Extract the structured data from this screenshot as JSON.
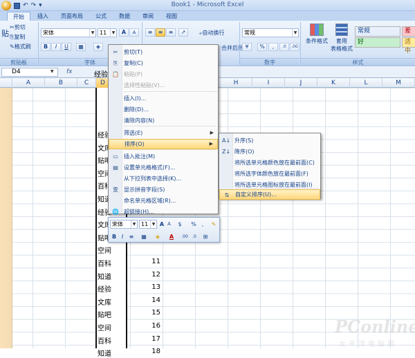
{
  "title_bar": {
    "title": "Book1 - Microsoft Excel",
    "qat": [
      "↶",
      "↷",
      "▾"
    ]
  },
  "tabs": [
    "开始",
    "插入",
    "页面布局",
    "公式",
    "数据",
    "审阅",
    "视图"
  ],
  "ribbon": {
    "clipboard": {
      "paste": "贴",
      "cut": "剪切",
      "copy": "复制",
      "format_painter": "格式刷",
      "label": "剪贴板"
    },
    "font": {
      "name": "宋体",
      "size": "11",
      "grow": "A",
      "shrink": "A",
      "bold": "B",
      "italic": "I",
      "underline": "U",
      "label": "字体"
    },
    "alignment": {
      "wrap": "自动换行",
      "merge": "合并后居中",
      "label": ""
    },
    "number": {
      "format": "常规",
      "percent": "%",
      "comma": ",",
      "label": "数字"
    },
    "styles": {
      "conditional": "条件格式",
      "table_format_1": "套用",
      "table_format_2": "表格格式",
      "cells": [
        {
          "text": "常规",
          "bg": "#ffffff",
          "fg": "#000000"
        },
        {
          "text": "差",
          "bg": "#ffc7ce",
          "fg": "#9c0006"
        },
        {
          "text": "好",
          "bg": "#c6efce",
          "fg": "#006100"
        },
        {
          "text": "适中",
          "bg": "#ffeb9c",
          "fg": "#9c6500"
        }
      ],
      "label": "样式"
    }
  },
  "formula_bar": {
    "name_box": "D4",
    "value": "经验"
  },
  "columns": [
    "A",
    "B",
    "C",
    "D",
    "H",
    "I",
    "J",
    "K",
    "L",
    "M"
  ],
  "sheet": {
    "d_column": [
      "经验",
      "文库",
      "贴吧",
      "空间",
      "百科",
      "知道",
      "经验",
      "文库",
      "贴吧",
      "空间",
      "百科",
      "知道",
      "经验",
      "文库",
      "贴吧",
      "空间",
      "百科",
      "知道"
    ],
    "e_numbers": [
      "",
      "",
      "",
      "",
      "",
      "",
      "",
      "",
      "",
      "",
      "11",
      "12",
      "13",
      "14",
      "15",
      "16",
      "17",
      "18"
    ]
  },
  "context_menu": [
    {
      "label": "剪切(T)",
      "icon": "✂",
      "state": "normal"
    },
    {
      "label": "复制(C)",
      "icon": "⎘",
      "state": "normal"
    },
    {
      "label": "粘贴(P)",
      "icon": "📋",
      "state": "disabled"
    },
    {
      "label": "选择性粘贴(V)...",
      "icon": "",
      "state": "disabled"
    },
    {
      "label": "插入(I)...",
      "icon": "",
      "state": "normal"
    },
    {
      "label": "删除(D)...",
      "icon": "",
      "state": "normal"
    },
    {
      "label": "清除内容(N)",
      "icon": "",
      "state": "normal"
    },
    {
      "label": "筛选(E)",
      "icon": "",
      "state": "normal",
      "submenu": true
    },
    {
      "label": "排序(O)",
      "icon": "",
      "state": "highlight",
      "submenu": true
    },
    {
      "label": "插入批注(M)",
      "icon": "▭",
      "state": "normal"
    },
    {
      "label": "设置单元格格式(F)...",
      "icon": "▤",
      "state": "normal"
    },
    {
      "label": "从下拉列表中选择(K)...",
      "icon": "",
      "state": "normal"
    },
    {
      "label": "显示拼音字段(S)",
      "icon": "变",
      "state": "normal"
    },
    {
      "label": "命名单元格区域(R)...",
      "icon": "",
      "state": "normal"
    },
    {
      "label": "超链接(H)...",
      "icon": "🌐",
      "state": "normal"
    }
  ],
  "sort_submenu": [
    {
      "label": "升序(S)",
      "icon": "A↓",
      "state": "normal"
    },
    {
      "label": "降序(O)",
      "icon": "Z↓",
      "state": "normal"
    },
    {
      "label": "将所选单元格颜色放在最前面(C)",
      "icon": "",
      "state": "normal"
    },
    {
      "label": "将所选字体颜色放在最前面(F)",
      "icon": "",
      "state": "normal"
    },
    {
      "label": "将所选单元格图标放在最前面(I)",
      "icon": "",
      "state": "normal"
    },
    {
      "label": "自定义排序(U)...",
      "icon": "⇅",
      "state": "highlight"
    }
  ],
  "mini_toolbar": {
    "font": "宋体",
    "size": "11",
    "percent": "%",
    "comma": ",",
    "bold": "B",
    "italic": "I",
    "align": "≡"
  },
  "watermark": {
    "brand": "PConline",
    "sub": "太平洋电脑网"
  },
  "colors": {
    "ribbon_blue": "#d7e5f7",
    "highlight": "#ffd77a",
    "tab_text": "#15428b"
  }
}
